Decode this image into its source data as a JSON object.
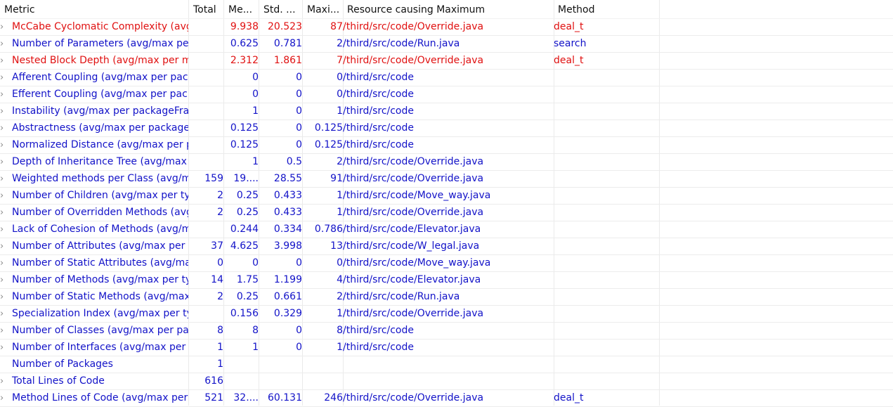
{
  "colors": {
    "normal_text": "#1212c8",
    "warning_text": "#e01010",
    "header_text": "#111111",
    "grid_line": "#eaeaea"
  },
  "columns": [
    "Metric",
    "Total",
    "Me...",
    "Std. ...",
    "Maxi...",
    "Resource causing Maximum",
    "Method"
  ],
  "rows": [
    {
      "metric": "McCabe Cyclomatic Complexity (avg/max per method)",
      "total": "",
      "mean": "9.938",
      "std": "20.523",
      "max": "87",
      "resource": "/third/src/code/Override.java",
      "method": "deal_t",
      "warn": true,
      "expandable": true
    },
    {
      "metric": "Number of Parameters (avg/max per method)",
      "total": "",
      "mean": "0.625",
      "std": "0.781",
      "max": "2",
      "resource": "/third/src/code/Run.java",
      "method": "search",
      "warn": false,
      "expandable": true
    },
    {
      "metric": "Nested Block Depth (avg/max per method)",
      "total": "",
      "mean": "2.312",
      "std": "1.861",
      "max": "7",
      "resource": "/third/src/code/Override.java",
      "method": "deal_t",
      "warn": true,
      "expandable": true
    },
    {
      "metric": "Afferent Coupling (avg/max per packageFragment)",
      "total": "",
      "mean": "0",
      "std": "0",
      "max": "0",
      "resource": "/third/src/code",
      "method": "",
      "warn": false,
      "expandable": true
    },
    {
      "metric": "Efferent Coupling (avg/max per packageFragment)",
      "total": "",
      "mean": "0",
      "std": "0",
      "max": "0",
      "resource": "/third/src/code",
      "method": "",
      "warn": false,
      "expandable": true
    },
    {
      "metric": "Instability (avg/max per packageFragment)",
      "total": "",
      "mean": "1",
      "std": "0",
      "max": "1",
      "resource": "/third/src/code",
      "method": "",
      "warn": false,
      "expandable": true
    },
    {
      "metric": "Abstractness (avg/max per packageFragment)",
      "total": "",
      "mean": "0.125",
      "std": "0",
      "max": "0.125",
      "resource": "/third/src/code",
      "method": "",
      "warn": false,
      "expandable": true
    },
    {
      "metric": "Normalized Distance (avg/max per packageFragment)",
      "total": "",
      "mean": "0.125",
      "std": "0",
      "max": "0.125",
      "resource": "/third/src/code",
      "method": "",
      "warn": false,
      "expandable": true
    },
    {
      "metric": "Depth of Inheritance Tree (avg/max per type)",
      "total": "",
      "mean": "1",
      "std": "0.5",
      "max": "2",
      "resource": "/third/src/code/Override.java",
      "method": "",
      "warn": false,
      "expandable": true
    },
    {
      "metric": "Weighted methods per Class (avg/max per type)",
      "total": "159",
      "mean": "19....",
      "std": "28.55",
      "max": "91",
      "resource": "/third/src/code/Override.java",
      "method": "",
      "warn": false,
      "expandable": true
    },
    {
      "metric": "Number of Children (avg/max per type)",
      "total": "2",
      "mean": "0.25",
      "std": "0.433",
      "max": "1",
      "resource": "/third/src/code/Move_way.java",
      "method": "",
      "warn": false,
      "expandable": true
    },
    {
      "metric": "Number of Overridden Methods (avg/max per type)",
      "total": "2",
      "mean": "0.25",
      "std": "0.433",
      "max": "1",
      "resource": "/third/src/code/Override.java",
      "method": "",
      "warn": false,
      "expandable": true
    },
    {
      "metric": "Lack of Cohesion of Methods (avg/max per type)",
      "total": "",
      "mean": "0.244",
      "std": "0.334",
      "max": "0.786",
      "resource": "/third/src/code/Elevator.java",
      "method": "",
      "warn": false,
      "expandable": true
    },
    {
      "metric": "Number of Attributes (avg/max per type)",
      "total": "37",
      "mean": "4.625",
      "std": "3.998",
      "max": "13",
      "resource": "/third/src/code/W_legal.java",
      "method": "",
      "warn": false,
      "expandable": true
    },
    {
      "metric": "Number of Static Attributes (avg/max per type)",
      "total": "0",
      "mean": "0",
      "std": "0",
      "max": "0",
      "resource": "/third/src/code/Move_way.java",
      "method": "",
      "warn": false,
      "expandable": true
    },
    {
      "metric": "Number of Methods (avg/max per type)",
      "total": "14",
      "mean": "1.75",
      "std": "1.199",
      "max": "4",
      "resource": "/third/src/code/Elevator.java",
      "method": "",
      "warn": false,
      "expandable": true
    },
    {
      "metric": "Number of Static Methods (avg/max per type)",
      "total": "2",
      "mean": "0.25",
      "std": "0.661",
      "max": "2",
      "resource": "/third/src/code/Run.java",
      "method": "",
      "warn": false,
      "expandable": true
    },
    {
      "metric": "Specialization Index (avg/max per type)",
      "total": "",
      "mean": "0.156",
      "std": "0.329",
      "max": "1",
      "resource": "/third/src/code/Override.java",
      "method": "",
      "warn": false,
      "expandable": true
    },
    {
      "metric": "Number of Classes (avg/max per packageFragment)",
      "total": "8",
      "mean": "8",
      "std": "0",
      "max": "8",
      "resource": "/third/src/code",
      "method": "",
      "warn": false,
      "expandable": true
    },
    {
      "metric": "Number of Interfaces (avg/max per packageFragment)",
      "total": "1",
      "mean": "1",
      "std": "0",
      "max": "1",
      "resource": "/third/src/code",
      "method": "",
      "warn": false,
      "expandable": true
    },
    {
      "metric": "Number of Packages",
      "total": "1",
      "mean": "",
      "std": "",
      "max": "",
      "resource": "",
      "method": "",
      "warn": false,
      "expandable": false
    },
    {
      "metric": "Total Lines of Code",
      "total": "616",
      "mean": "",
      "std": "",
      "max": "",
      "resource": "",
      "method": "",
      "warn": false,
      "expandable": true
    },
    {
      "metric": "Method Lines of Code (avg/max per method)",
      "total": "521",
      "mean": "32....",
      "std": "60.131",
      "max": "246",
      "resource": "/third/src/code/Override.java",
      "method": "deal_t",
      "warn": false,
      "expandable": true
    }
  ]
}
